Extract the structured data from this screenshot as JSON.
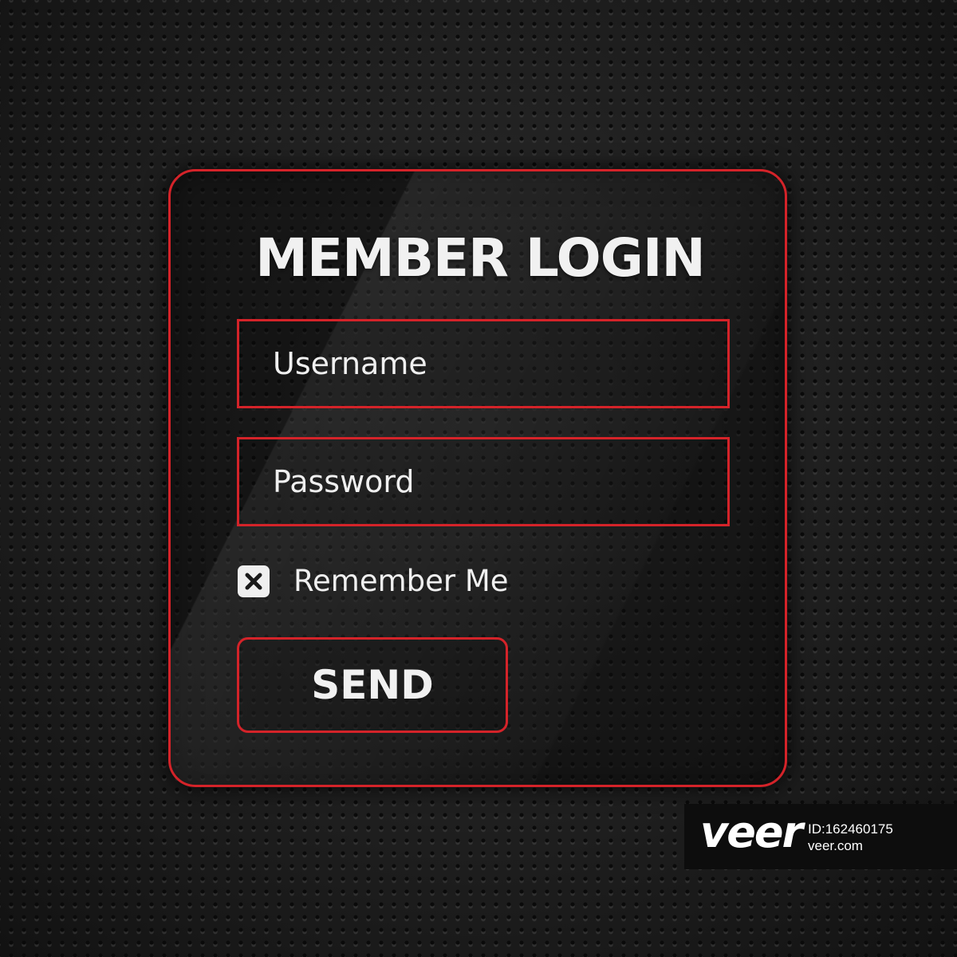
{
  "login": {
    "title": "MEMBER LOGIN",
    "username_placeholder": "Username",
    "password_placeholder": "Password",
    "remember_label": "Remember Me",
    "remember_checked": true,
    "send_label": "SEND"
  },
  "watermark": {
    "logo": "veer",
    "id": "ID:162460175",
    "site": "veer.com"
  },
  "colors": {
    "accent": "#d42329",
    "background": "#1e1e1e",
    "text": "#f1f1f1"
  },
  "icons": {
    "checkbox": "close-x-icon"
  }
}
